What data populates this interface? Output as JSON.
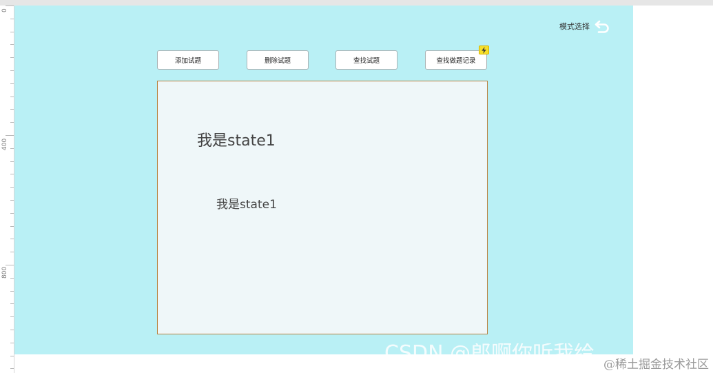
{
  "ruler": {
    "labels": [
      "0",
      "400",
      "800"
    ]
  },
  "header": {
    "mode_select_label": "模式选择",
    "mode_select_icon": "undo-arrow-icon"
  },
  "toolbar": {
    "buttons": [
      {
        "label": "添加试题"
      },
      {
        "label": "删除试题"
      },
      {
        "label": "查找试题"
      },
      {
        "label": "查找做题记录",
        "badge_icon": "lightning-bolt-icon"
      }
    ]
  },
  "panel": {
    "state_primary": "我是state1",
    "state_secondary": "我是state1"
  },
  "watermarks": {
    "csdn": "CSDN @郎啊你听我给",
    "juejin": "@稀土掘金技术社区"
  },
  "colors": {
    "canvas_bg": "#b9f0f5",
    "panel_bg": "#eff7f9",
    "panel_border": "#b8803c",
    "badge": "#f6df2a"
  }
}
